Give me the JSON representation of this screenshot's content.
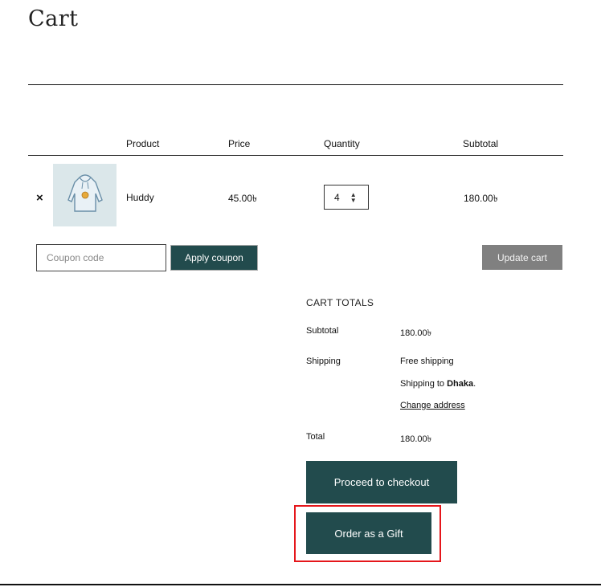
{
  "page": {
    "title": "Cart"
  },
  "table": {
    "headers": {
      "product": "Product",
      "price": "Price",
      "quantity": "Quantity",
      "subtotal": "Subtotal"
    },
    "rows": [
      {
        "remove": "×",
        "product_name": "Huddy",
        "price": "45.00৳",
        "quantity": "4",
        "subtotal": "180.00৳",
        "thumbnail": "hoodie-image"
      }
    ]
  },
  "coupon": {
    "placeholder": "Coupon code",
    "apply_label": "Apply coupon"
  },
  "update_label": "Update cart",
  "totals": {
    "title": "CART TOTALS",
    "subtotal_label": "Subtotal",
    "subtotal_value": "180.00৳",
    "shipping_label": "Shipping",
    "shipping_method": "Free shipping",
    "shipping_to_prefix": "Shipping to ",
    "shipping_to_city": "Dhaka",
    "shipping_to_suffix": ".",
    "change_address": "Change address",
    "total_label": "Total",
    "total_value": "180.00৳"
  },
  "actions": {
    "checkout_label": "Proceed to checkout",
    "gift_label": "Order as a Gift"
  },
  "colors": {
    "primary": "#224b4d",
    "update_button": "#808080",
    "highlight": "#e5161b"
  }
}
